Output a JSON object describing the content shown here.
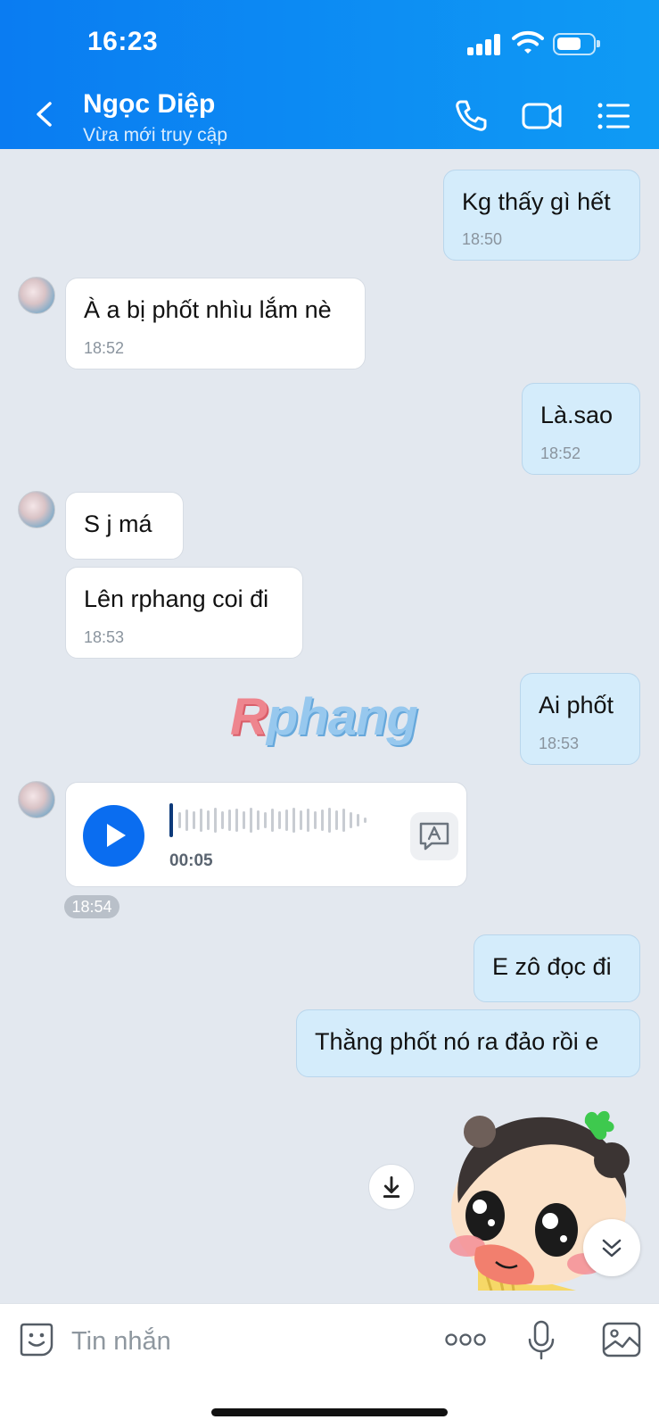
{
  "status_bar": {
    "time": "16:23"
  },
  "header": {
    "contact_name": "Ngọc Diệp",
    "contact_status": "Vừa mới truy cập",
    "icons": [
      "back-icon",
      "phone-icon",
      "video-call-icon",
      "menu-list-icon"
    ]
  },
  "messages": [
    {
      "dir": "out",
      "text": "Kg thấy gì hết",
      "time": "18:50"
    },
    {
      "dir": "in",
      "text": "À a bị phốt nhìu lắm nè",
      "time": "18:52"
    },
    {
      "dir": "out",
      "text": "Là.sao",
      "time": "18:52"
    },
    {
      "dir": "in",
      "text": "S j má",
      "time": ""
    },
    {
      "dir": "in",
      "text": "Lên rphang coi đi",
      "time": "18:53"
    },
    {
      "dir": "out",
      "text": "Ai phốt",
      "time": "18:53"
    },
    {
      "dir": "out",
      "text": "E zô đọc đi",
      "time": ""
    },
    {
      "dir": "out",
      "text": "Thằng phốt nó ra đảo rồi e",
      "time": ""
    }
  ],
  "voice_message": {
    "duration": "00:05",
    "time": "18:54"
  },
  "watermark": {
    "first": "R",
    "rest": "phang"
  },
  "composer": {
    "placeholder": "Tin nhắn"
  },
  "colors": {
    "header_blue": "#0a7cf2",
    "outgoing_bubble": "#d4ecfb",
    "incoming_bubble": "#ffffff",
    "chat_bg": "#e3e8ef"
  }
}
